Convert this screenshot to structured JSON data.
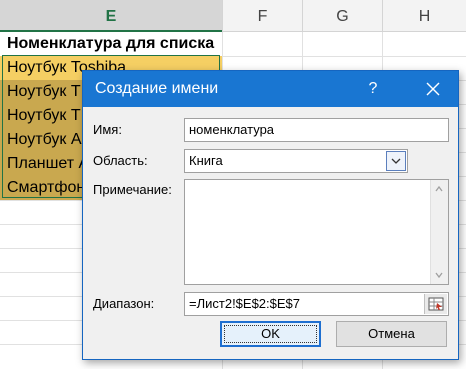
{
  "spreadsheet": {
    "columns": [
      "E",
      "F",
      "G",
      "H"
    ],
    "header_cell": "Номенклатура для списка",
    "rows": [
      "Ноутбук Toshiba",
      "Ноутбук T",
      "Ноутбук T",
      "Ноутбук A",
      "Планшет A",
      "Смартфон"
    ]
  },
  "dialog": {
    "title": "Создание имени",
    "help_label": "?",
    "name_label": "Имя:",
    "name_value": "номенклатура",
    "scope_label": "Область:",
    "scope_value": "Книга",
    "comment_label": "Примечание:",
    "comment_value": "",
    "range_label": "Диапазон:",
    "range_value": "=Лист2!$E$2:$E$7",
    "ok_label": "OK",
    "cancel_label": "Отмена"
  },
  "colors": {
    "accent": "#1976d2",
    "excel_green": "#217346",
    "first_row_fill": "#f5cf63",
    "selected_fill": "#c9a84f"
  }
}
